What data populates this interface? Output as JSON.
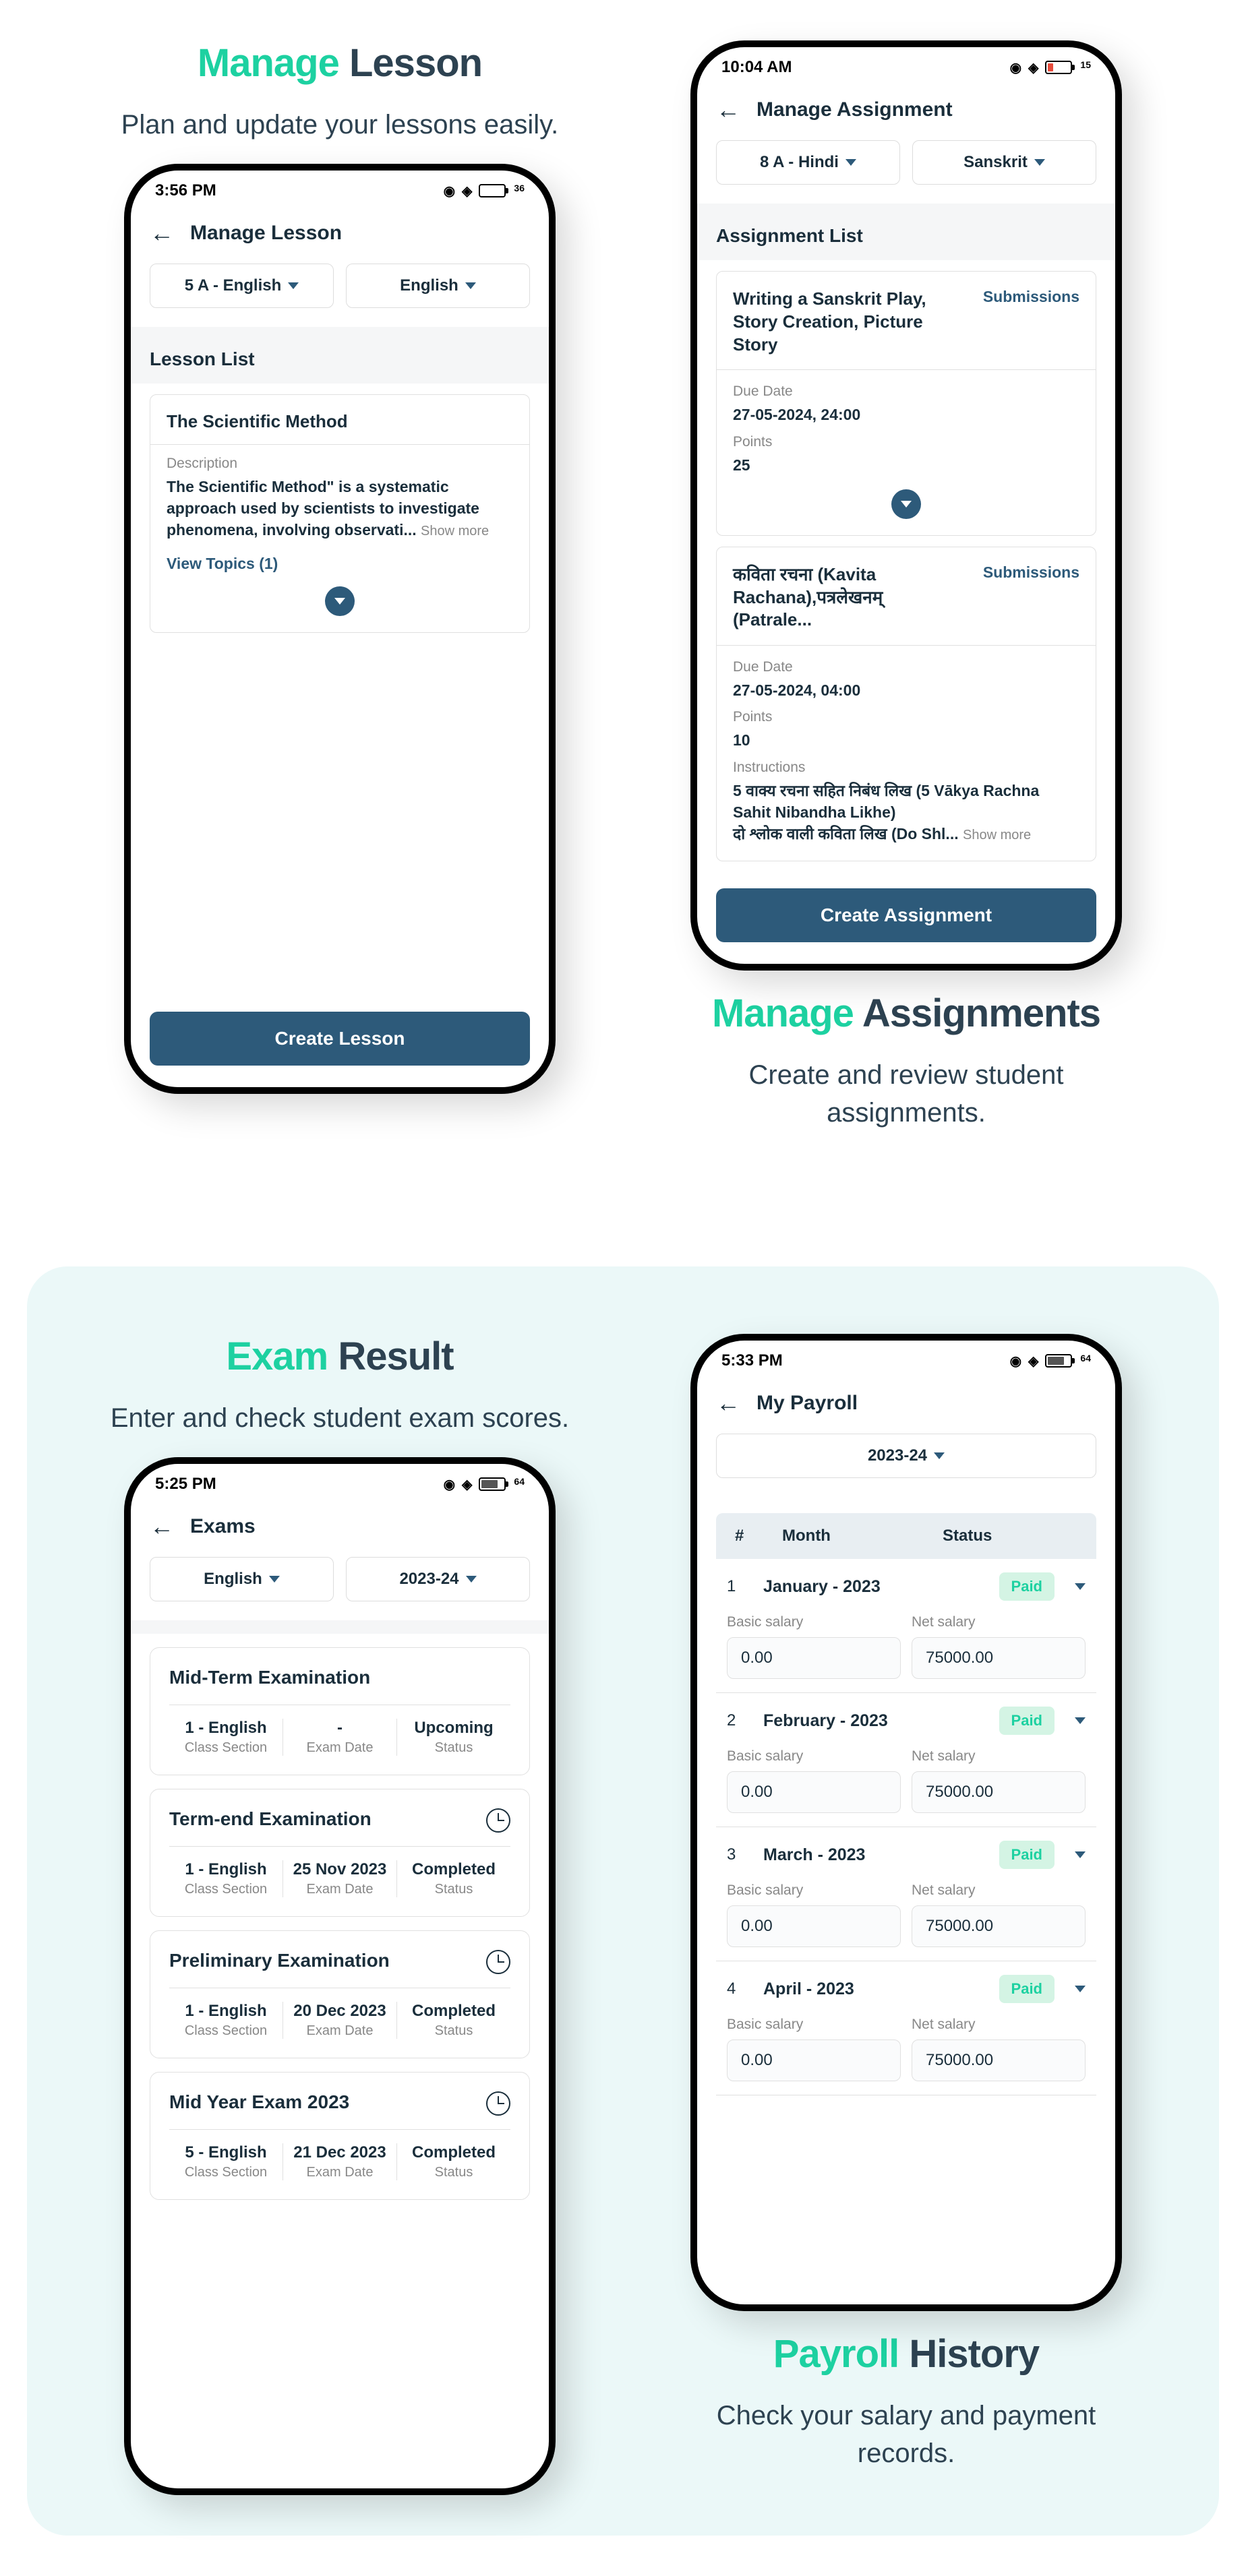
{
  "lesson": {
    "title_accent": "Manage",
    "title_dark": "Lesson",
    "subtitle": "Plan and update your lessons easily.",
    "time": "3:56 PM",
    "battery": "36",
    "header": "Manage Lesson",
    "filter1": "5 A - English",
    "filter2": "English",
    "list_title": "Lesson List",
    "card_title": "The Scientific Method",
    "desc_label": "Description",
    "desc_text": "The Scientific Method\" is a systematic approach used by scientists to investigate phenomena, involving observati...",
    "show_more": "Show more",
    "view_topics": "View Topics (1)",
    "button": "Create Lesson"
  },
  "assign": {
    "title_accent": "Manage",
    "title_dark": "Assignments",
    "subtitle": "Create and review student assignments.",
    "time": "10:04 AM",
    "battery": "15",
    "header": "Manage Assignment",
    "filter1": "8 A - Hindi",
    "filter2": "Sanskrit",
    "list_title": "Assignment List",
    "submissions": "Submissions",
    "a1_title": "Writing a Sanskrit Play, Story Creation, Picture Story",
    "due_label": "Due Date",
    "a1_due": "27-05-2024, 24:00",
    "points_label": "Points",
    "a1_points": "25",
    "a2_title": "कविता रचना (Kavita Rachana),पत्रलेखनम् (Patrale...",
    "a2_due": "27-05-2024, 04:00",
    "a2_points": "10",
    "instr_label": "Instructions",
    "a2_instr": "5 वाक्य रचना सहित निबंध लिख (5 Vākya Rachna Sahit Nibandha Likhe)\nदो श्लोक वाली कविता लिख (Do Shl...",
    "button": "Create Assignment"
  },
  "exam": {
    "title_accent": "Exam",
    "title_dark": "Result",
    "subtitle": "Enter and check student exam scores.",
    "time": "5:25 PM",
    "battery": "64",
    "header": "Exams",
    "filter1": "English",
    "filter2": "2023-24",
    "class_lbl": "Class Section",
    "date_lbl": "Exam Date",
    "status_lbl": "Status",
    "exams": [
      {
        "title": "Mid-Term Examination",
        "class": "1 - English",
        "date": "-",
        "status": "Upcoming",
        "clock": false
      },
      {
        "title": "Term-end Examination",
        "class": "1 - English",
        "date": "25 Nov 2023",
        "status": "Completed",
        "clock": true
      },
      {
        "title": "Preliminary Examination",
        "class": "1 - English",
        "date": "20 Dec 2023",
        "status": "Completed",
        "clock": true
      },
      {
        "title": "Mid Year Exam 2023",
        "class": "5 - English",
        "date": "21 Dec 2023",
        "status": "Completed",
        "clock": true
      }
    ]
  },
  "payroll": {
    "title_accent": "Payroll",
    "title_dark": "History",
    "subtitle": "Check your salary and payment records.",
    "time": "5:33 PM",
    "battery": "64",
    "header": "My Payroll",
    "year": "2023-24",
    "col1": "#",
    "col2": "Month",
    "col3": "Status",
    "basic_lbl": "Basic salary",
    "net_lbl": "Net salary",
    "rows": [
      {
        "idx": "1",
        "month": "January - 2023",
        "status": "Paid",
        "basic": "0.00",
        "net": "75000.00"
      },
      {
        "idx": "2",
        "month": "February - 2023",
        "status": "Paid",
        "basic": "0.00",
        "net": "75000.00"
      },
      {
        "idx": "3",
        "month": "March - 2023",
        "status": "Paid",
        "basic": "0.00",
        "net": "75000.00"
      },
      {
        "idx": "4",
        "month": "April - 2023",
        "status": "Paid",
        "basic": "0.00",
        "net": "75000.00"
      }
    ]
  }
}
